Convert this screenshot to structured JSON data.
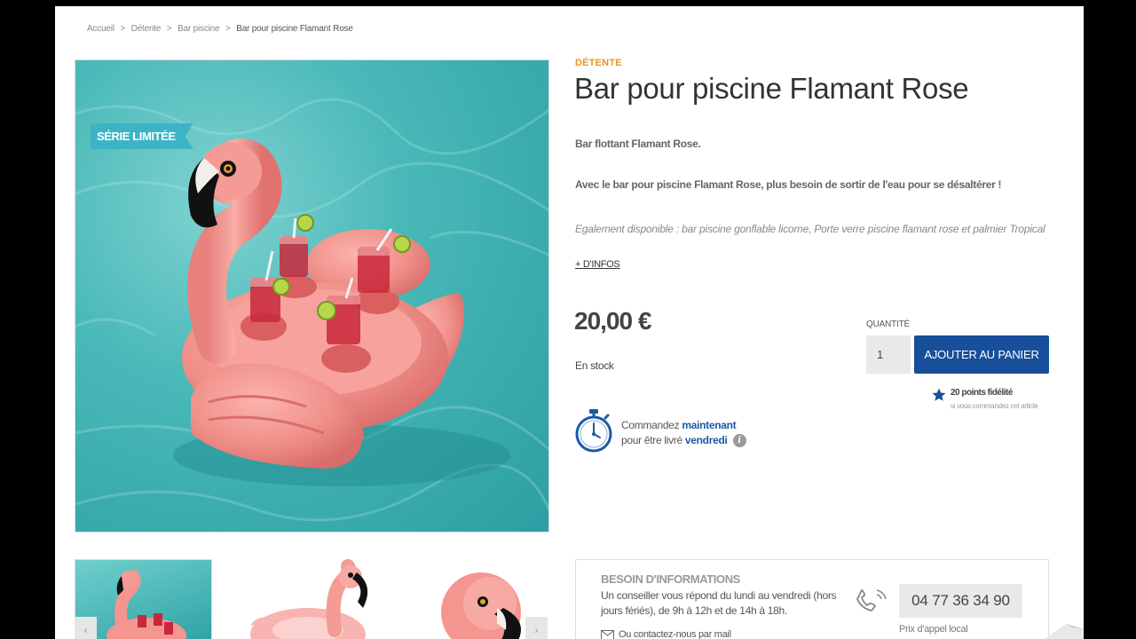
{
  "breadcrumb": {
    "items": [
      "Accueil",
      "Détente",
      "Bar piscine"
    ],
    "current": "Bar pour piscine Flamant Rose",
    "separator": ">"
  },
  "product": {
    "badge": "SÉRIE LIMITÉE",
    "category": "DÉTENTE",
    "title": "Bar pour piscine Flamant Rose",
    "short_description_1": "Bar flottant Flamant Rose.",
    "short_description_2": "Avec le bar pour piscine Flamant Rose, plus besoin de sortir de l'eau pour se désaltérer !",
    "also_available": "Egalement disponible : bar piscine gonflable licorne, Porte verre piscine flamant rose et palmier Tropical",
    "more_info_link": "+ D'INFOS",
    "price": "20,00 €",
    "stock": "En stock",
    "quantity_label": "QUANTITÉ",
    "quantity_value": "1",
    "add_to_cart_label": "AJOUTER AU PANIER",
    "loyalty_points": "20 points fidélité",
    "loyalty_note": "si vous commandez cet article"
  },
  "delivery": {
    "line1_prefix": "Commandez ",
    "line1_highlight": "maintenant",
    "line2_prefix": "pour être livré ",
    "line2_highlight": "vendredi",
    "info_glyph": "i"
  },
  "help_box": {
    "title": "BESOIN D'INFORMATIONS",
    "text": "Un conseiller vous répond du lundi au vendredi (hors jours fériés), de 9h à 12h et de 14h à 18h.",
    "mail_link": "Ou contactez-nous par mail",
    "phone": "04 77 36 34 90",
    "phone_note": "Prix d'appel local"
  },
  "icons": {
    "zoom": "zoom-in-icon",
    "star": "star-icon",
    "timer": "stopwatch-icon",
    "phone": "phone-icon",
    "mail": "mail-icon",
    "arrow_left": "chevron-left-icon",
    "arrow_right": "chevron-right-icon"
  },
  "colors": {
    "accent_orange": "#e8951e",
    "primary_blue": "#174f9a",
    "ribbon_teal": "#3cb4c6",
    "highlight_blue": "#1c5aa5"
  },
  "thumbnails": {
    "arrow_left": "‹",
    "arrow_right": "›"
  }
}
